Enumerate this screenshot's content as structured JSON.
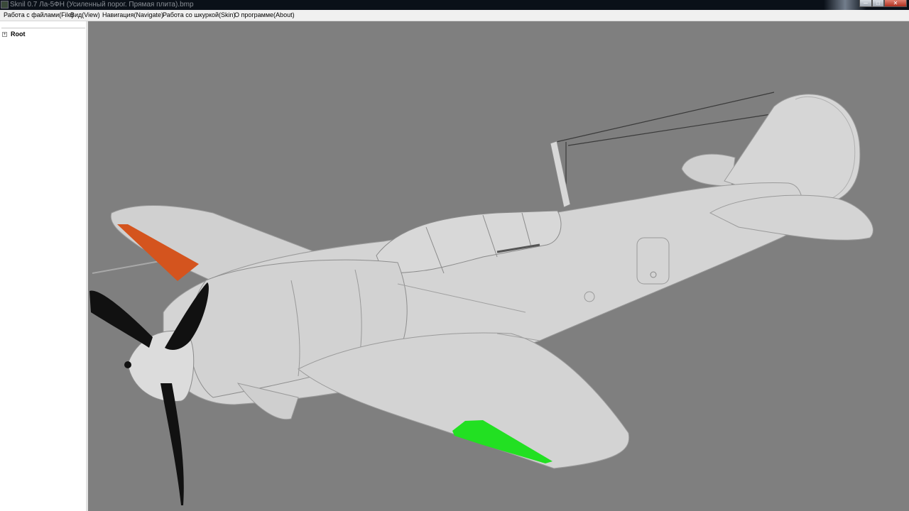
{
  "window": {
    "title": "Sknil 0.7   Ла-5ФН (Усиленный порог. Прямая плита).bmp",
    "controls": {
      "minimize": "─",
      "maximize": "□",
      "close": "✕"
    }
  },
  "menu": {
    "file": "Работа с файлами(File)",
    "view": "Вид(View)",
    "navigate": "Навигация(Navigate)",
    "skin": "Работа со шкуркой(Skin)",
    "about": "О программе(About)"
  },
  "tree": {
    "root_label": "Root",
    "root_expander": "+"
  },
  "viewport": {
    "background_color": "#7f7f7f",
    "model_color": "#d3d3d3",
    "highlight_orange": "#d4541e",
    "highlight_green": "#22e022",
    "propeller_color": "#111111"
  }
}
